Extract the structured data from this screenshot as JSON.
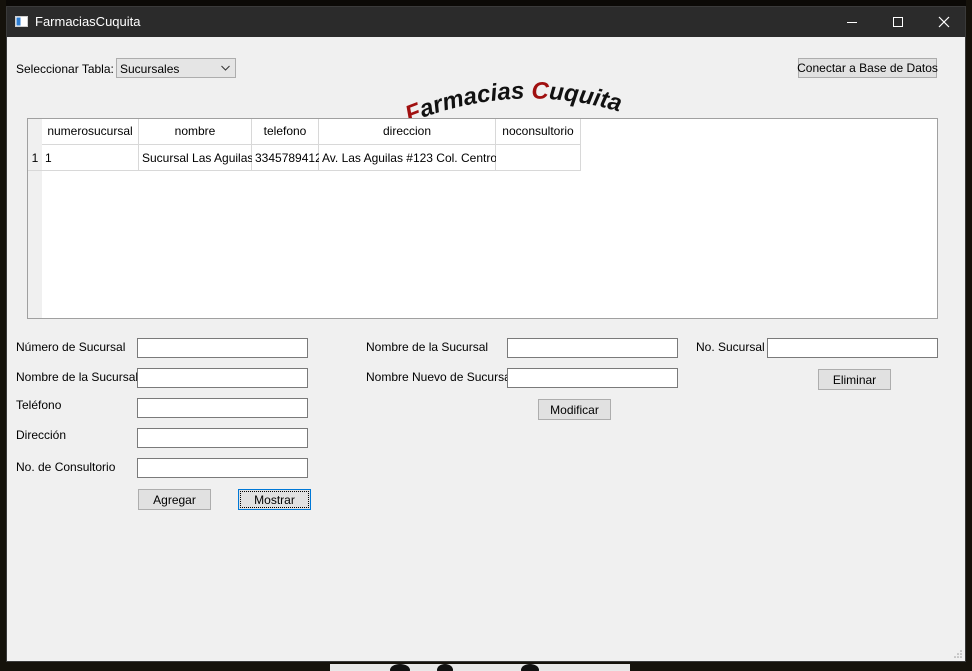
{
  "window": {
    "title": "FarmaciasCuquita"
  },
  "top": {
    "select_label": "Seleccionar Tabla:",
    "table_select_value": "Sucursales",
    "connect_button": "Conectar a Base de Datos"
  },
  "logo": {
    "first_letter": "F",
    "first_rest": "armacias ",
    "second_letter": "C",
    "second_rest": "uquita",
    "accent_color": "#a01010",
    "text_color": "#111111"
  },
  "table": {
    "columns": [
      "numerosucursal",
      "nombre",
      "telefono",
      "direccion",
      "noconsultorio"
    ],
    "rows": [
      {
        "row_number": "1",
        "cells": [
          "1",
          "Sucursal Las Aguilas",
          "3345789412",
          "Av. Las Aguilas #123 Col. Centro",
          ""
        ]
      }
    ]
  },
  "add_form": {
    "numero_label": "Número de Sucursal",
    "nombre_label": "Nombre de la Sucursal",
    "telefono_label": "Teléfono",
    "direccion_label": "Dirección",
    "consultorio_label": "No. de Consultorio",
    "numero_value": "",
    "nombre_value": "",
    "telefono_value": "",
    "direccion_value": "",
    "consultorio_value": "",
    "add_button": "Agregar",
    "show_button": "Mostrar"
  },
  "modify_form": {
    "nombre_label": "Nombre de la Sucursal",
    "nuevo_label": "Nombre Nuevo de Sucursal",
    "nombre_value": "",
    "nuevo_value": "",
    "modify_button": "Modificar"
  },
  "delete_form": {
    "sucursal_label": "No. Sucursal",
    "sucursal_value": "",
    "delete_button": "Eliminar"
  }
}
